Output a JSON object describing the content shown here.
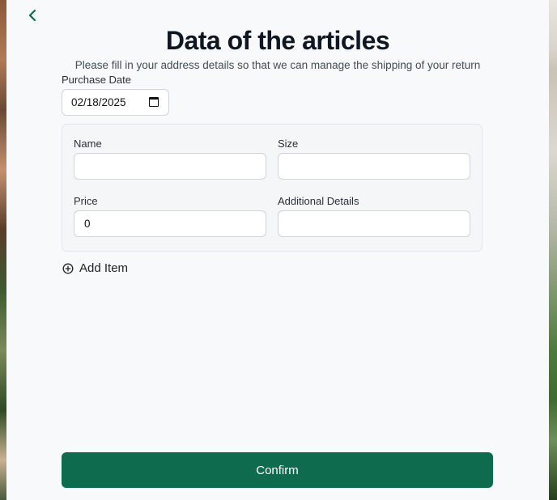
{
  "page": {
    "title": "Data of the articles",
    "subtitle": "Please fill in your address details so that we can manage the shipping of your return"
  },
  "purchase_date": {
    "label": "Purchase Date",
    "value": "02/18/2025",
    "icon": "calendar-icon"
  },
  "item_form": {
    "name_label": "Name",
    "name_value": "",
    "size_label": "Size",
    "size_value": "",
    "price_label": "Price",
    "price_value": "0",
    "details_label": "Additional Details",
    "details_value": ""
  },
  "add_item": {
    "label": "Add Item",
    "icon": "plus-circle-icon"
  },
  "confirm": {
    "label": "Confirm"
  },
  "colors": {
    "accent": "#0e6b4e",
    "title": "#0f1722",
    "panel_bg": "#f7f9fa"
  }
}
